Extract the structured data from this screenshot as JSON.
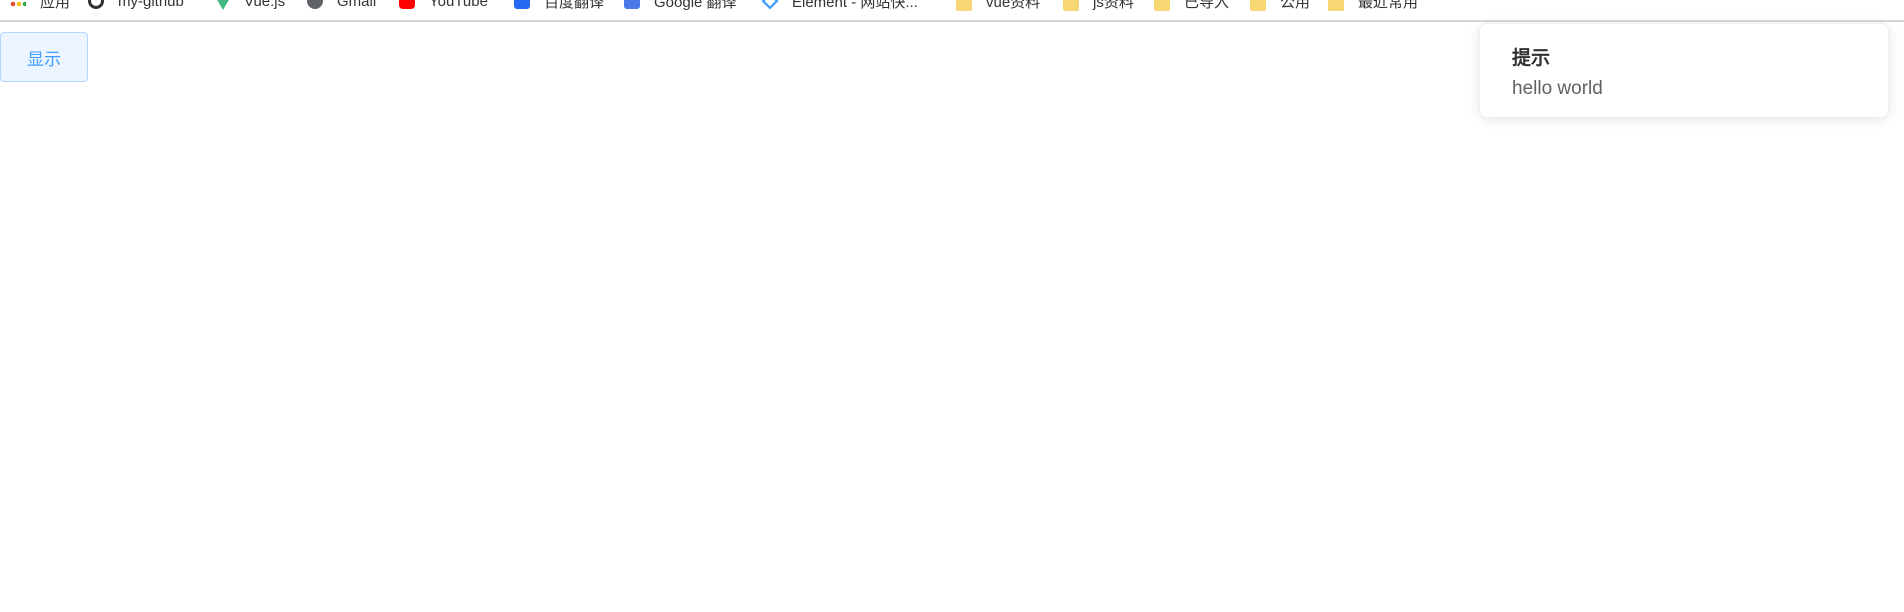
{
  "bookmarks": [
    {
      "label": "应用",
      "icon": "apps-grid-icon"
    },
    {
      "label": "my-github",
      "icon": "github-icon"
    },
    {
      "label": "Vue.js",
      "icon": "vue-logo-icon"
    },
    {
      "label": "Gmail",
      "icon": "gmail-icon"
    },
    {
      "label": "YouTube",
      "icon": "youtube-icon"
    },
    {
      "label": "百度翻译",
      "icon": "baidu-translate-icon"
    },
    {
      "label": "Google 翻译",
      "icon": "google-translate-icon"
    },
    {
      "label": "Element - 网站快...",
      "icon": "element-logo-icon"
    },
    {
      "label": "vue资料",
      "icon": "folder-icon"
    },
    {
      "label": "js资料",
      "icon": "folder-icon"
    },
    {
      "label": "已导入",
      "icon": "folder-icon"
    },
    {
      "label": "公用",
      "icon": "folder-icon"
    },
    {
      "label": "最近常用",
      "icon": "folder-icon"
    }
  ],
  "main": {
    "show_button_label": "显示"
  },
  "notification": {
    "title": "提示",
    "message": "hello world"
  },
  "colors": {
    "primary": "#409eff",
    "button_bg": "#ecf5ff",
    "button_border": "#b3d8ff",
    "title_text": "#303133",
    "message_text": "#606266"
  }
}
